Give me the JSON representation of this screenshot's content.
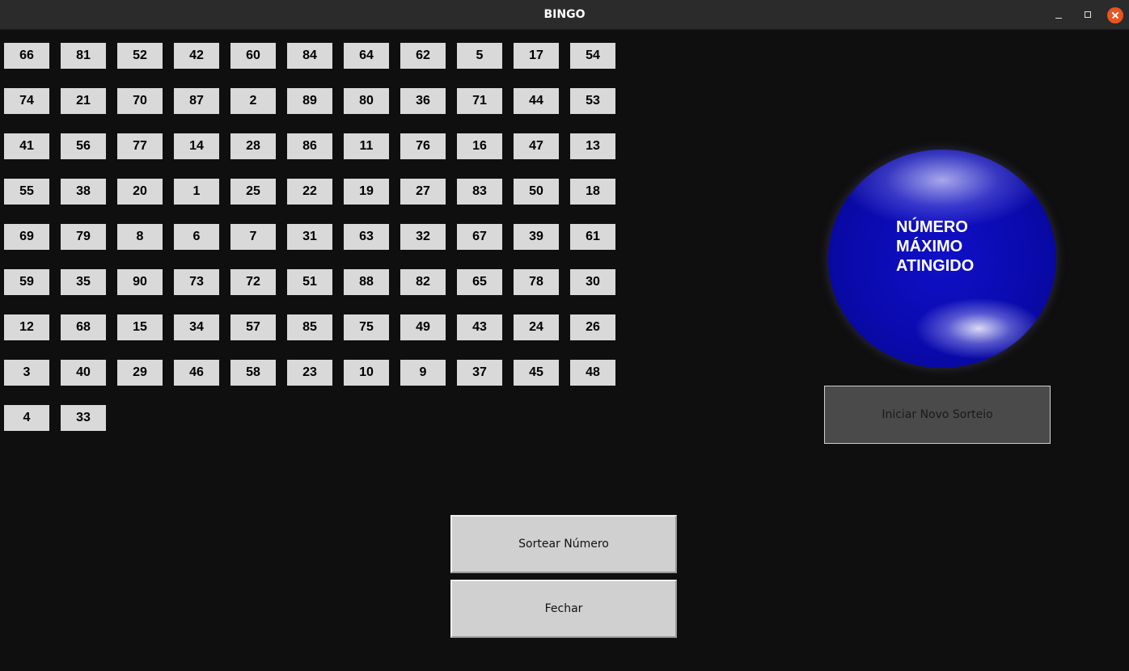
{
  "window": {
    "title": "BINGO"
  },
  "board": {
    "rows": [
      [
        "66",
        "81",
        "52",
        "42",
        "60",
        "84",
        "64",
        "62",
        "5",
        "17",
        "54"
      ],
      [
        "74",
        "21",
        "70",
        "87",
        "2",
        "89",
        "80",
        "36",
        "71",
        "44",
        "53"
      ],
      [
        "41",
        "56",
        "77",
        "14",
        "28",
        "86",
        "11",
        "76",
        "16",
        "47",
        "13"
      ],
      [
        "55",
        "38",
        "20",
        "1",
        "25",
        "22",
        "19",
        "27",
        "83",
        "50",
        "18"
      ],
      [
        "69",
        "79",
        "8",
        "6",
        "7",
        "31",
        "63",
        "32",
        "67",
        "39",
        "61"
      ],
      [
        "59",
        "35",
        "90",
        "73",
        "72",
        "51",
        "88",
        "82",
        "65",
        "78",
        "30"
      ],
      [
        "12",
        "68",
        "15",
        "34",
        "57",
        "85",
        "75",
        "49",
        "43",
        "24",
        "26"
      ],
      [
        "3",
        "40",
        "29",
        "46",
        "58",
        "23",
        "10",
        "9",
        "37",
        "45",
        "48"
      ],
      [
        "4",
        "33"
      ]
    ]
  },
  "ball": {
    "lines": [
      "NÚMERO",
      "MÁXIMO",
      "ATINGIDO"
    ]
  },
  "buttons": {
    "new_draw": "Iniciar Novo Sorteio",
    "draw_number": "Sortear Número",
    "close": "Fechar"
  },
  "icons": {
    "minimize": "minimize-icon",
    "maximize": "maximize-icon",
    "close": "close-icon"
  },
  "colors": {
    "background": "#0f0f0f",
    "cell": "#d9d9d9",
    "ball": "#0a0aae",
    "close_button": "#e95420"
  }
}
